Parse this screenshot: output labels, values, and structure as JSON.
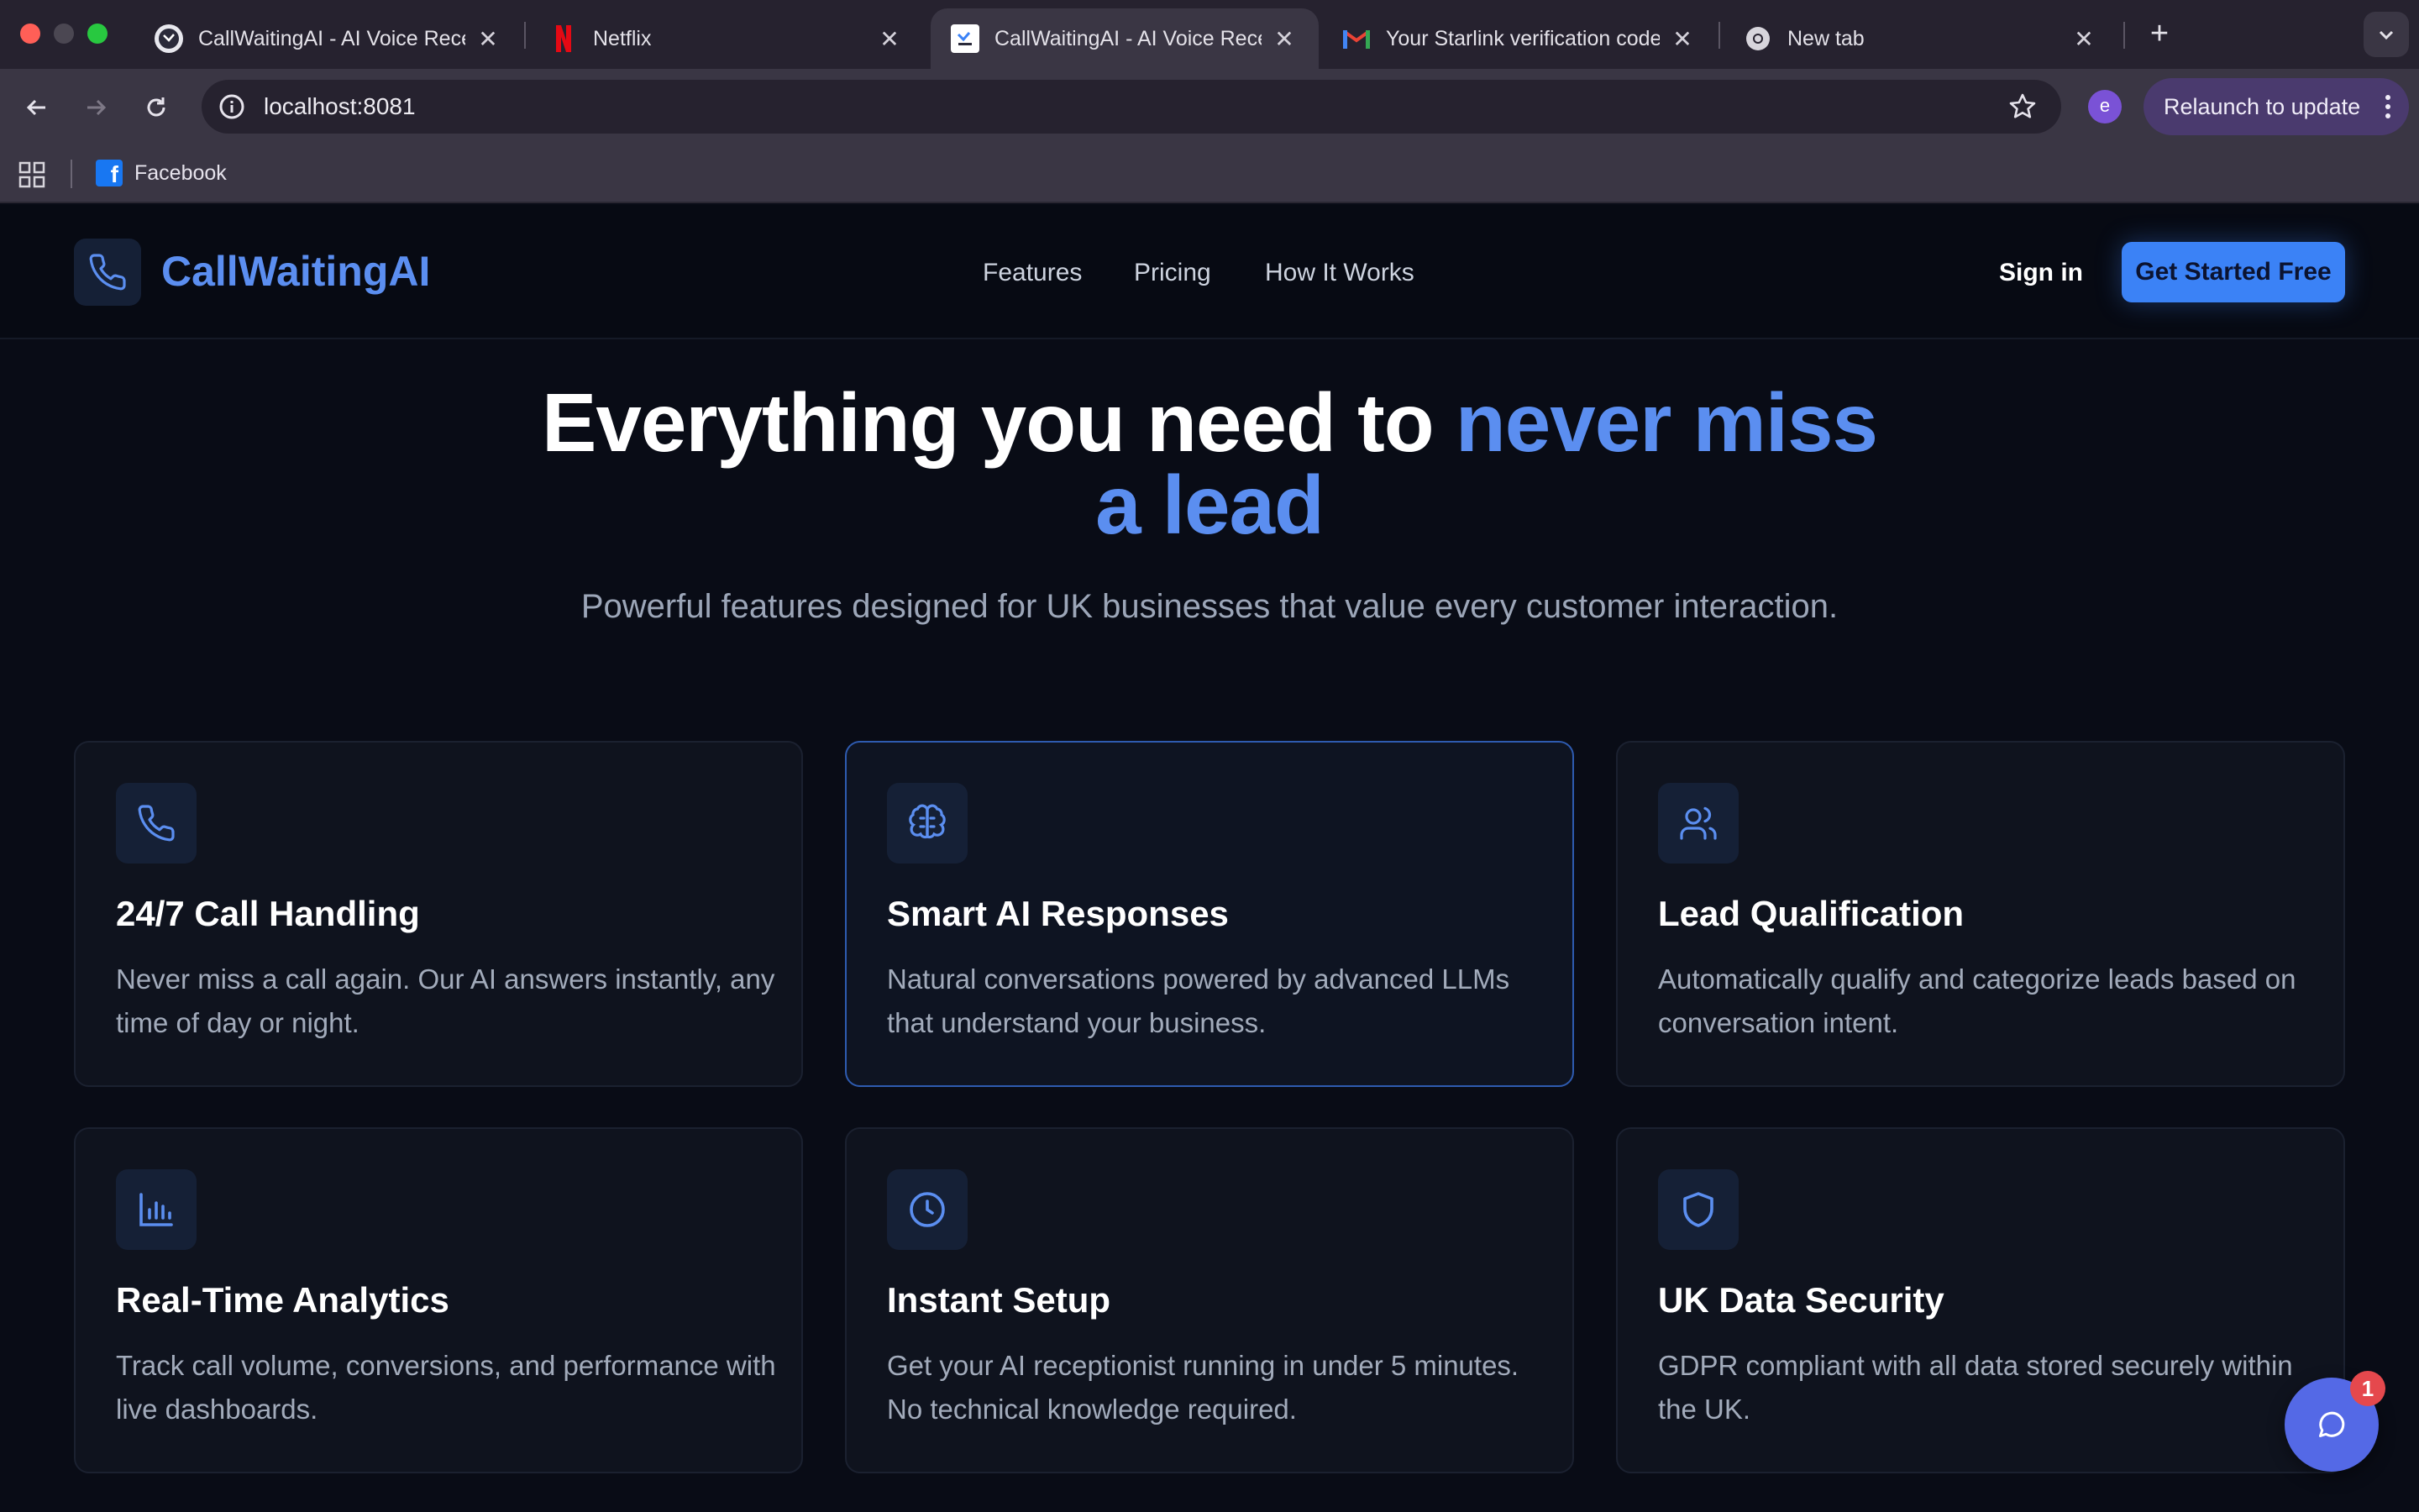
{
  "browser": {
    "tabs": [
      {
        "title": "CallWaitingAI - AI Voice Recep",
        "active": false,
        "favicon": "callwaiting-favicon-icon"
      },
      {
        "title": "Netflix",
        "active": false,
        "favicon": "netflix-icon"
      },
      {
        "title": "CallWaitingAI - AI Voice Recep",
        "active": true,
        "favicon": "callwaiting-favicon-icon"
      },
      {
        "title": "Your Starlink verification code",
        "active": false,
        "favicon": "gmail-icon"
      },
      {
        "title": "New tab",
        "active": false,
        "favicon": "chrome-icon"
      }
    ],
    "url": "localhost:8081",
    "profile_initial": "e",
    "relaunch_label": "Relaunch to update",
    "bookmarks": [
      {
        "label": "Facebook",
        "icon": "facebook-icon"
      }
    ]
  },
  "site": {
    "logo_text": "CallWaitingAI",
    "nav": [
      "Features",
      "Pricing",
      "How It Works"
    ],
    "signin_label": "Sign in",
    "cta_label": "Get Started Free"
  },
  "hero": {
    "title_plain": "Everything you need to ",
    "title_accent_1": "never miss",
    "title_accent_2": "a lead",
    "subtitle": "Powerful features designed for UK businesses that value every customer interaction."
  },
  "features": [
    {
      "title": "24/7 Call Handling",
      "desc": "Never miss a call again. Our AI answers instantly, any time of day or night.",
      "icon": "phone-icon"
    },
    {
      "title": "Smart AI Responses",
      "desc": "Natural conversations powered by advanced LLMs that understand your business.",
      "icon": "brain-icon"
    },
    {
      "title": "Lead Qualification",
      "desc": "Automatically qualify and categorize leads based on conversation intent.",
      "icon": "users-icon"
    },
    {
      "title": "Real-Time Analytics",
      "desc": "Track call volume, conversions, and performance with live dashboards.",
      "icon": "bar-chart-icon"
    },
    {
      "title": "Instant Setup",
      "desc": "Get your AI receptionist running in under 5 minutes. No technical knowledge required.",
      "icon": "clock-icon"
    },
    {
      "title": "UK Data Security",
      "desc": "GDPR compliant with all data stored securely within the UK.",
      "icon": "shield-icon"
    }
  ],
  "chat": {
    "badge_count": "1",
    "icon": "chat-bubble-icon"
  },
  "colors": {
    "accent": "#5b8ef0",
    "cta": "#3b82f6",
    "background": "#090c16",
    "card": "#0f131e"
  }
}
